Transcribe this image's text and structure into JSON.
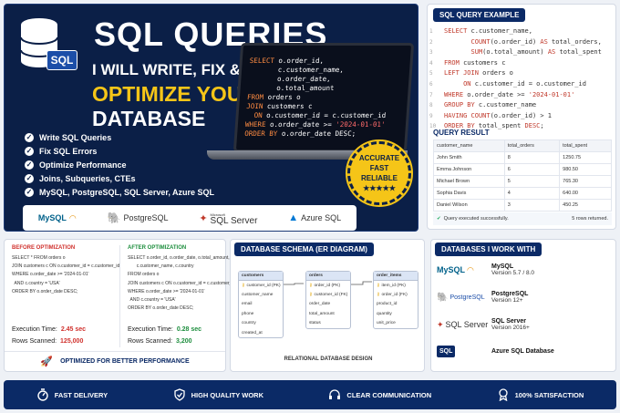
{
  "hero": {
    "title": "SQL QUERIES",
    "sql_badge": "SQL",
    "line1": "I WILL WRITE, FIX &",
    "line2": "OPTIMIZE YOUR",
    "line3": "DATABASE",
    "features": [
      "Write SQL Queries",
      "Fix SQL Errors",
      "Optimize Performance",
      "Joins, Subqueries, CTEs",
      "MySQL, PostgreSQL, SQL Server, Azure SQL"
    ],
    "badge": [
      "ACCURATE",
      "FAST",
      "RELIABLE",
      "★★★★★"
    ],
    "code_lines": [
      [
        "SELECT",
        " o.order_id,"
      ],
      [
        "",
        "       c.customer_name,"
      ],
      [
        "",
        "       o.order_date,"
      ],
      [
        "",
        "       o.total_amount"
      ],
      [
        "FROM",
        " orders o"
      ],
      [
        "JOIN",
        " customers c"
      ],
      [
        "  ON",
        " o.customer_id = c.customer_id"
      ],
      [
        "WHERE",
        " o.order_date >= '2024-01-01'"
      ],
      [
        "ORDER BY",
        " o.order_date DESC;"
      ]
    ],
    "logos": [
      "MySQL",
      "PostgreSQL",
      "SQL Server",
      "Azure SQL"
    ],
    "logo_sub": "Microsoft"
  },
  "example": {
    "tag": "SQL QUERY EXAMPLE",
    "code": [
      "SELECT c.customer_name,",
      "       COUNT(o.order_id) AS total_orders,",
      "       SUM(o.total_amount) AS total_spent",
      "FROM customers c",
      "LEFT JOIN orders o",
      "     ON c.customer_id = o.customer_id",
      "WHERE o.order_date >= '2024-01-01'",
      "GROUP BY c.customer_name",
      "HAVING COUNT(o.order_id) > 1",
      "ORDER BY total_spent DESC;"
    ],
    "result_title": "QUERY RESULT",
    "columns": [
      "customer_name",
      "total_orders",
      "total_spent"
    ],
    "rows": [
      [
        "John Smith",
        "8",
        "1250.75"
      ],
      [
        "Emma Johnson",
        "6",
        "980.50"
      ],
      [
        "Michael Brown",
        "5",
        "765.30"
      ],
      [
        "Sophia Davis",
        "4",
        "640.00"
      ],
      [
        "Daniel Wilson",
        "3",
        "450.25"
      ]
    ],
    "status_left": "Query executed successfully.",
    "status_right": "5 rows returned."
  },
  "before_after": {
    "before_title": "BEFORE OPTIMIZATION",
    "before_code": "SELECT * FROM orders o\nJOIN customers c ON o.customer_id = c.customer_id\nWHERE o.order_date >= '2024-01-01'\n  AND c.country = 'USA'\nORDER BY o.order_date DESC;",
    "after_title": "AFTER OPTIMIZATION",
    "after_code": "SELECT o.order_id, o.order_date, o.total_amount,\n       c.customer_name, c.country\nFROM orders o\nJOIN customers c ON o.customer_id = c.customer_id\nWHERE o.order_date >= '2024-01-01'\n  AND c.country = 'USA'\nORDER BY o.order_date DESC;",
    "exec_label": "Execution Time:",
    "rows_label": "Rows Scanned:",
    "before_exec": "2.45 sec",
    "before_rows": "125,000",
    "after_exec": "0.28 sec",
    "after_rows": "3,200",
    "footer": "OPTIMIZED FOR BETTER PERFORMANCE",
    "colors": {
      "before": "#d0312d",
      "after": "#1e8e3e"
    }
  },
  "schema": {
    "tag": "DATABASE SCHEMA (ER DIAGRAM)",
    "tables": [
      {
        "name": "customers",
        "cols": [
          [
            "customer_id (PK)",
            true
          ],
          [
            "customer_name",
            false
          ],
          [
            "email",
            false
          ],
          [
            "phone",
            false
          ],
          [
            "country",
            false
          ],
          [
            "created_at",
            false
          ]
        ]
      },
      {
        "name": "orders",
        "cols": [
          [
            "order_id (PK)",
            true
          ],
          [
            "customer_id (FK)",
            true
          ],
          [
            "order_date",
            false
          ],
          [
            "total_amount",
            false
          ],
          [
            "status",
            false
          ]
        ]
      },
      {
        "name": "order_items",
        "cols": [
          [
            "item_id (PK)",
            true
          ],
          [
            "order_id (FK)",
            true
          ],
          [
            "product_id",
            false
          ],
          [
            "quantity",
            false
          ],
          [
            "unit_price",
            false
          ]
        ]
      }
    ],
    "caption": "RELATIONAL DATABASE DESIGN"
  },
  "databases": {
    "tag": "DATABASES I WORK WITH",
    "items": [
      {
        "logo": "MySQL",
        "name": "MySQL",
        "version": "Version 5.7 / 8.0"
      },
      {
        "logo": "PostgreSQL",
        "name": "PostgreSQL",
        "version": "Version 12+"
      },
      {
        "logo": "SQL Server",
        "name": "SQL Server",
        "version": "Version 2016+"
      },
      {
        "logo": "SQL",
        "name": "Azure SQL Database",
        "version": ""
      }
    ]
  },
  "footer": {
    "items": [
      "FAST DELIVERY",
      "HIGH QUALITY WORK",
      "CLEAR COMMUNICATION",
      "100% SATISFACTION"
    ]
  }
}
